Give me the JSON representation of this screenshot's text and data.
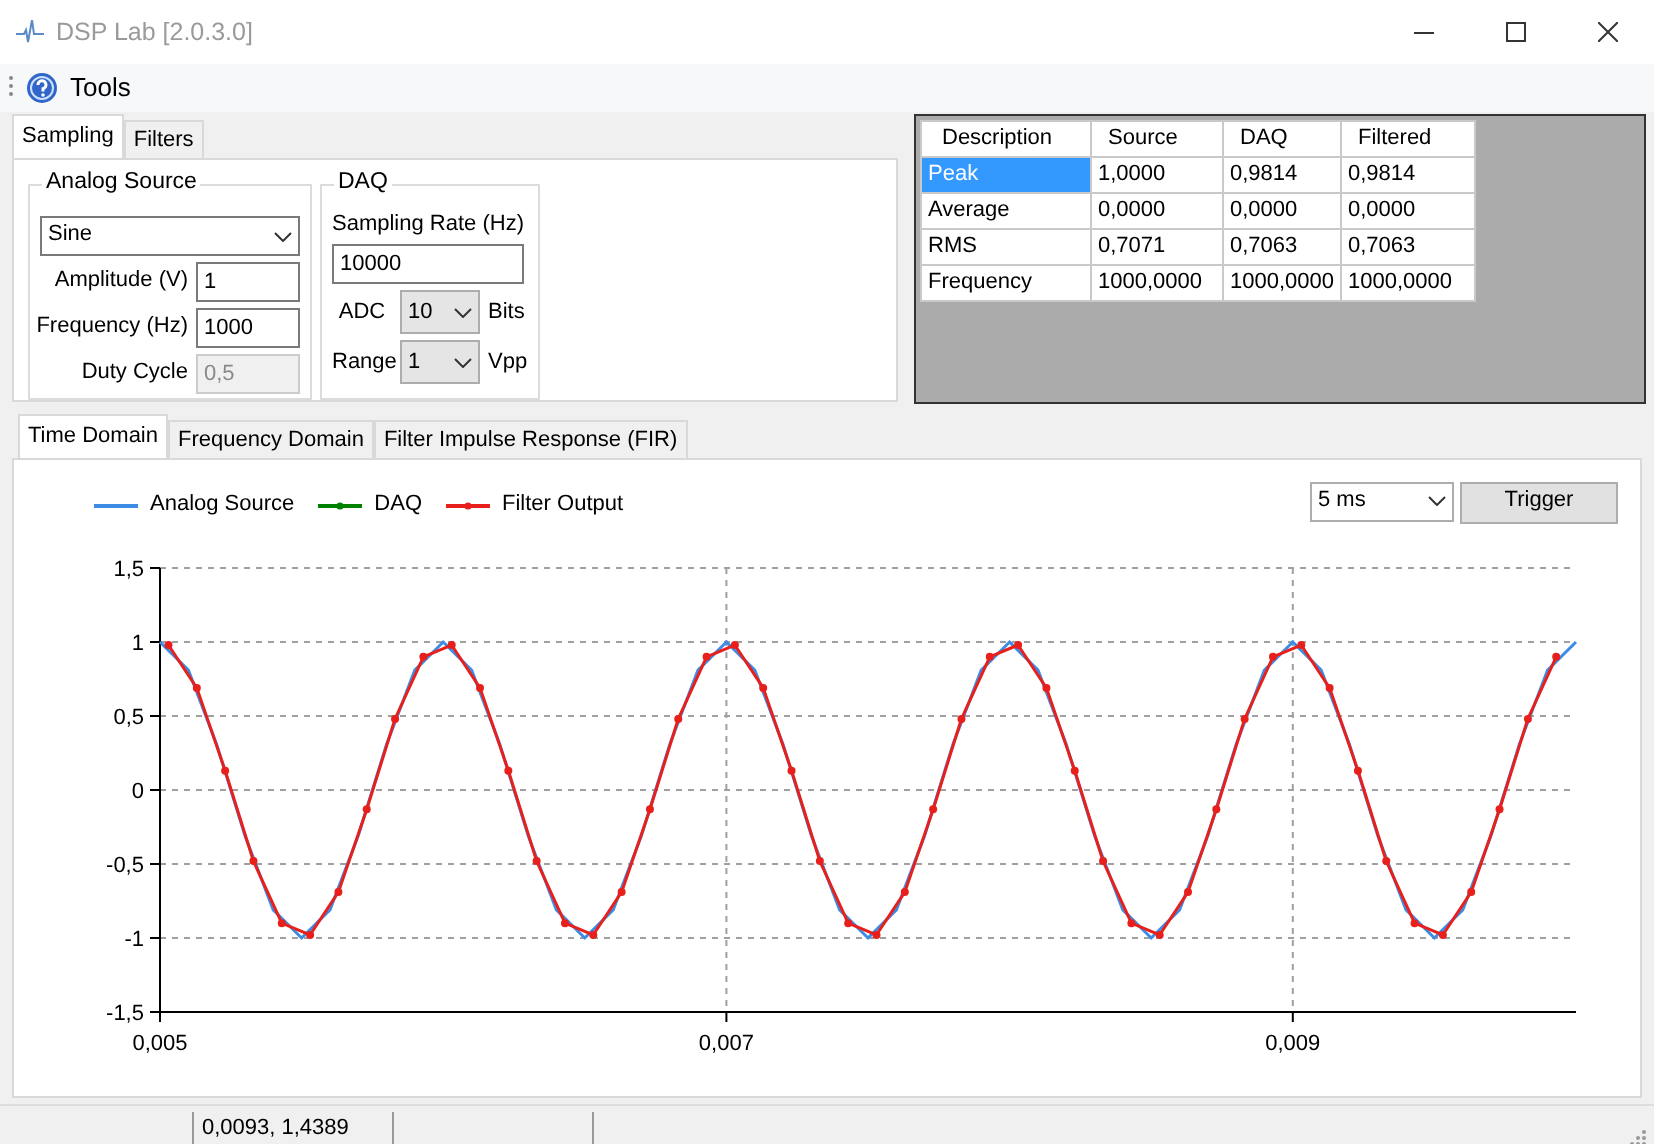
{
  "window": {
    "title": "DSP Lab [2.0.3.0]"
  },
  "menu": [
    {
      "label": "Tools"
    }
  ],
  "top_tabs": [
    {
      "label": "Sampling",
      "selected": true
    },
    {
      "label": "Filters",
      "selected": false
    }
  ],
  "analog_source": {
    "title": "Analog Source",
    "waveform": "Sine",
    "fields": [
      {
        "label": "Amplitude (V)",
        "value": "1",
        "disabled": false
      },
      {
        "label": "Frequency (Hz)",
        "value": "1000",
        "disabled": false
      },
      {
        "label": "Duty Cycle",
        "value": "0,5",
        "disabled": true
      }
    ]
  },
  "daq": {
    "title": "DAQ",
    "sampling_rate_label": "Sampling Rate (Hz)",
    "sampling_rate": "10000",
    "adc": {
      "label": "ADC",
      "value": "10",
      "unit": "Bits"
    },
    "range": {
      "label": "Range",
      "value": "1",
      "unit": "Vpp"
    }
  },
  "stats_table": {
    "columns": [
      "Description",
      "Source",
      "DAQ",
      "Filtered"
    ],
    "rows": [
      {
        "cells": [
          "Peak",
          "1,0000",
          "0,9814",
          "0,9814"
        ],
        "selected": true
      },
      {
        "cells": [
          "Average",
          "0,0000",
          "0,0000",
          "0,0000"
        ],
        "selected": false
      },
      {
        "cells": [
          "RMS",
          "0,7071",
          "0,7063",
          "0,7063"
        ],
        "selected": false
      },
      {
        "cells": [
          "Frequency",
          "1000,0000",
          "1000,0000",
          "1000,0000"
        ],
        "selected": false
      }
    ]
  },
  "chart_tabs": [
    {
      "label": "Time Domain",
      "selected": true
    },
    {
      "label": "Frequency Domain",
      "selected": false
    },
    {
      "label": "Filter Impulse Response (FIR)",
      "selected": false
    }
  ],
  "timebase": "5 ms",
  "trigger_button": "Trigger",
  "chart": {
    "chart_data": {
      "type": "line",
      "grid": true,
      "x": [
        0.00503,
        0.00513,
        0.00523,
        0.00533,
        0.00543,
        0.00553,
        0.00563,
        0.00573,
        0.00583,
        0.00593,
        0.00603,
        0.00613,
        0.00623,
        0.00633,
        0.00643,
        0.00653,
        0.00663,
        0.00673,
        0.00683,
        0.00693,
        0.00703,
        0.00713,
        0.00723,
        0.00733,
        0.00743,
        0.00753,
        0.00763,
        0.00773,
        0.00783,
        0.00793,
        0.00803,
        0.00813,
        0.00823,
        0.00833,
        0.00843,
        0.00853,
        0.00863,
        0.00873,
        0.00883,
        0.00893,
        0.00903,
        0.00913,
        0.00923,
        0.00933,
        0.00943,
        0.00953,
        0.00963,
        0.00973,
        0.00983,
        0.00993
      ],
      "series": [
        {
          "name": "Analog Source",
          "color": "#3c8ce6",
          "marker": false,
          "x": [
            0.005,
            0.0051,
            0.0052,
            0.0053,
            0.0054,
            0.0055,
            0.0056,
            0.0057,
            0.0058,
            0.0059,
            0.006,
            0.0061,
            0.0062,
            0.0063,
            0.0064,
            0.0065,
            0.0066,
            0.0067,
            0.0068,
            0.0069,
            0.007,
            0.0071,
            0.0072,
            0.0073,
            0.0074,
            0.0075,
            0.0076,
            0.0077,
            0.0078,
            0.0079,
            0.008,
            0.0081,
            0.0082,
            0.0083,
            0.0084,
            0.0085,
            0.0086,
            0.0087,
            0.0088,
            0.0089,
            0.009,
            0.0091,
            0.0092,
            0.0093,
            0.0094,
            0.0095,
            0.0096,
            0.0097,
            0.0098,
            0.0099,
            0.01
          ],
          "values": [
            1,
            0.81,
            0.31,
            -0.31,
            -0.81,
            -1,
            -0.81,
            -0.31,
            0.31,
            0.81,
            1,
            0.81,
            0.31,
            -0.31,
            -0.81,
            -1,
            -0.81,
            -0.31,
            0.31,
            0.81,
            1,
            0.81,
            0.31,
            -0.31,
            -0.81,
            -1,
            -0.81,
            -0.31,
            0.31,
            0.81,
            1,
            0.81,
            0.31,
            -0.31,
            -0.81,
            -1,
            -0.81,
            -0.31,
            0.31,
            0.81,
            1,
            0.81,
            0.31,
            -0.31,
            -0.81,
            -1,
            -0.81,
            -0.31,
            0.31,
            0.81,
            1
          ]
        },
        {
          "name": "DAQ",
          "color": "#008000",
          "marker": true,
          "values": [
            null,
            null,
            null,
            null,
            null,
            null,
            null,
            null,
            null,
            null,
            null,
            null,
            null,
            null,
            null,
            null,
            null,
            null,
            null,
            null,
            null,
            null,
            null,
            null,
            null,
            null,
            null,
            null,
            null,
            null,
            null,
            null,
            null,
            null,
            null,
            null,
            null,
            null,
            null,
            null,
            null,
            null,
            null,
            null,
            null,
            null,
            null,
            null,
            null,
            null
          ]
        },
        {
          "name": "Filter Output",
          "color": "#e8201c",
          "marker": true,
          "values": [
            0.98,
            0.69,
            0.13,
            -0.48,
            -0.9,
            -0.98,
            -0.69,
            -0.13,
            0.48,
            0.9,
            0.98,
            0.69,
            0.13,
            -0.48,
            -0.9,
            -0.98,
            -0.69,
            -0.13,
            0.48,
            0.9,
            0.98,
            0.69,
            0.13,
            -0.48,
            -0.9,
            -0.98,
            -0.69,
            -0.13,
            0.48,
            0.9,
            0.98,
            0.69,
            0.13,
            -0.48,
            -0.9,
            -0.98,
            -0.69,
            -0.13,
            0.48,
            0.9,
            0.98,
            0.69,
            0.13,
            -0.48,
            -0.9,
            -0.98,
            -0.69,
            -0.13,
            0.48,
            0.9
          ]
        }
      ],
      "xlim": [
        0.005,
        0.01
      ],
      "ylim": [
        -1.5,
        1.5
      ],
      "xticks": [
        {
          "value": 0.005,
          "label": "0,005"
        },
        {
          "value": 0.007,
          "label": "0,007"
        },
        {
          "value": 0.009,
          "label": "0,009"
        }
      ],
      "yticks": [
        {
          "value": -1.5,
          "label": "-1,5"
        },
        {
          "value": -1,
          "label": "-1"
        },
        {
          "value": -0.5,
          "label": "-0,5"
        },
        {
          "value": 0,
          "label": "0"
        },
        {
          "value": 0.5,
          "label": "0,5"
        },
        {
          "value": 1,
          "label": "1"
        },
        {
          "value": 1.5,
          "label": "1,5"
        }
      ]
    }
  },
  "status_bar": {
    "position": "0,0093, 1,4389"
  }
}
